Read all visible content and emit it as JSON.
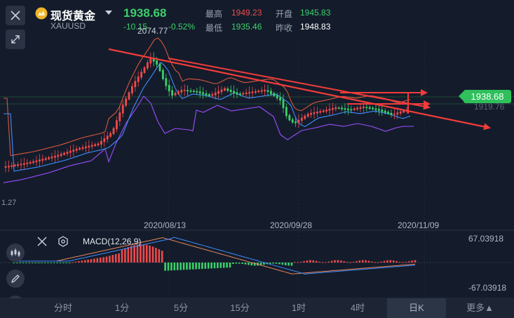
{
  "instrument": {
    "name": "现货黄金",
    "code": "XAUUSD",
    "price": "1938.68",
    "change": "-10.15",
    "change_pct": "-0.52%",
    "stats": [
      {
        "label": "最高",
        "value": "1949.23",
        "color": "#f04a4a"
      },
      {
        "label": "开盘",
        "value": "1945.83",
        "color": "#3bd06a"
      },
      {
        "label": "最低",
        "value": "1935.46",
        "color": "#3bd06a"
      },
      {
        "label": "昨收",
        "value": "1948.83",
        "color": "#ffffff"
      }
    ]
  },
  "main_chart": {
    "peak_label": "2074.77",
    "low_label_partial": "1.27",
    "current_price_badge": "1938.68",
    "ghost_price_label": "1919.76",
    "date_labels": [
      "2020/08/13",
      "2020/09/28",
      "2020/11/09"
    ]
  },
  "macd": {
    "label": "MACD(12,26,9)",
    "top_value": "67.03918",
    "bottom_value": "-67.03918"
  },
  "timeframes": {
    "tabs": [
      "分时",
      "1分",
      "5分",
      "15分",
      "1时",
      "4时",
      "日K",
      "更多▲"
    ],
    "active": "日K"
  },
  "colors": {
    "background": "#141c2b",
    "up": "#f04a4a",
    "down": "#3bd06a",
    "ma": "#3e8cff",
    "band_upper": "#d8553c",
    "band_lower": "#9b4dff",
    "trend_arrows": "#f23c3c",
    "badge": "#2fbf5b",
    "logo": "#f0b429"
  },
  "icons": [
    "close-icon",
    "expand-icon",
    "candle-icon",
    "pen-icon",
    "indicator-icon",
    "settings-icon",
    "dropdown-caret-icon",
    "gold-logo-icon"
  ]
}
